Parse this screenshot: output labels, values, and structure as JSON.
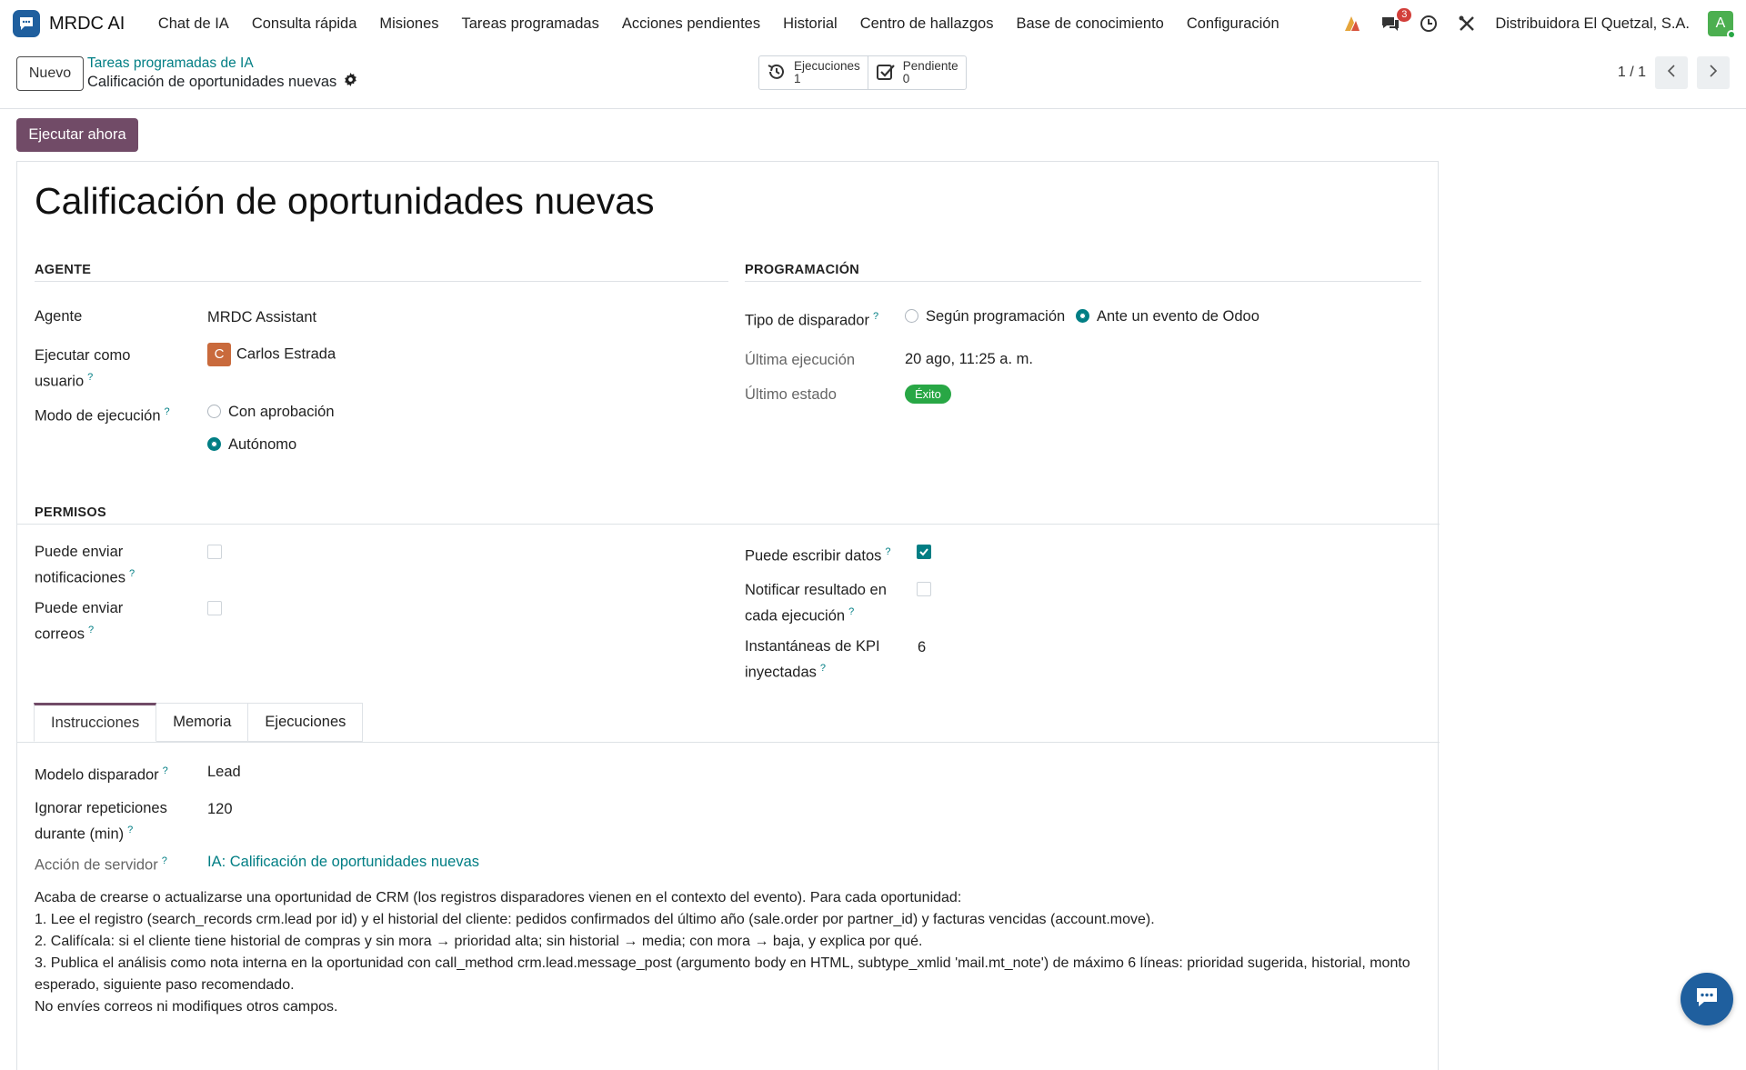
{
  "app": {
    "name": "MRDC AI"
  },
  "menu": [
    "Chat de IA",
    "Consulta rápida",
    "Misiones",
    "Tareas programadas",
    "Acciones pendientes",
    "Historial",
    "Centro de hallazgos",
    "Base de conocimiento",
    "Configuración"
  ],
  "systray": {
    "messages_count": "3",
    "company": "Distribuidora El Quetzal, S.A.",
    "avatar_initial": "A"
  },
  "control": {
    "new_label": "Nuevo",
    "breadcrumb_parent": "Tareas programadas de IA",
    "breadcrumb_current": "Calificación de oportunidades nuevas",
    "stat_runs_label": "Ejecuciones",
    "stat_runs_value": "1",
    "stat_pending_label": "Pendiente",
    "stat_pending_value": "0",
    "pager": "1 / 1"
  },
  "actions": {
    "run_now": "Ejecutar ahora"
  },
  "record": {
    "title": "Calificación de oportunidades nuevas",
    "agent_section": "AGENTE",
    "agent_label": "Agente",
    "agent_value": "MRDC Assistant",
    "run_as_label_1": "Ejecutar como",
    "run_as_label_2": "usuario",
    "run_as_initial": "C",
    "run_as_value": "Carlos Estrada",
    "mode_label": "Modo de ejecución",
    "mode_opt1": "Con aprobación",
    "mode_opt2": "Autónomo",
    "mode_selected": "Autónomo",
    "schedule_section": "PROGRAMACIÓN",
    "trigger_label": "Tipo de disparador",
    "trigger_opt1": "Según programación",
    "trigger_opt2": "Ante un evento de Odoo",
    "trigger_selected": "Ante un evento de Odoo",
    "last_run_label": "Última ejecución",
    "last_run_value": "20 ago, 11:25 a. m.",
    "last_state_label": "Último estado",
    "last_state_value": "Éxito",
    "permissions_section": "PERMISOS",
    "notify_label_1": "Puede enviar",
    "notify_label_2": "notificaciones",
    "notify_checked": false,
    "mail_label_1": "Puede enviar",
    "mail_label_2": "correos",
    "mail_checked": false,
    "write_label": "Puede escribir datos",
    "write_checked": true,
    "notify_result_label_1": "Notificar resultado en",
    "notify_result_label_2": "cada ejecución",
    "notify_result_checked": false,
    "kpi_label_1": "Instantáneas de KPI",
    "kpi_label_2": "inyectadas",
    "kpi_value": "6"
  },
  "tabs": [
    "Instrucciones",
    "Memoria",
    "Ejecuciones"
  ],
  "instructions": {
    "model_label": "Modelo disparador",
    "model_value": "Lead",
    "ignore_label_1": "Ignorar repeticiones",
    "ignore_label_2": "durante (min)",
    "ignore_value": "120",
    "server_action_label": "Acción de servidor",
    "server_action_value": "IA: Calificación de oportunidades nuevas",
    "text": [
      "Acaba de crearse o actualizarse una oportunidad de CRM (los registros disparadores vienen en el contexto del evento). Para cada oportunidad:",
      "1. Lee el registro (search_records crm.lead por id) y el historial del cliente: pedidos confirmados del último año (sale.order por partner_id) y facturas vencidas (account.move).",
      "2. Califícala: si el cliente tiene historial de compras y sin mora → prioridad alta; sin historial → media; con mora → baja, y explica por qué.",
      "3. Publica el análisis como nota interna en la oportunidad con call_method crm.lead.message_post (argumento body en HTML, subtype_xmlid 'mail.mt_note') de máximo 6 líneas: prioridad sugerida, historial, monto esperado, siguiente paso recomendado.",
      "No envíes correos ni modifiques otros campos."
    ]
  },
  "colors": {
    "brand": "#714b67",
    "link": "#017e84",
    "success": "#28a745",
    "logo": "#1f5f9e"
  }
}
